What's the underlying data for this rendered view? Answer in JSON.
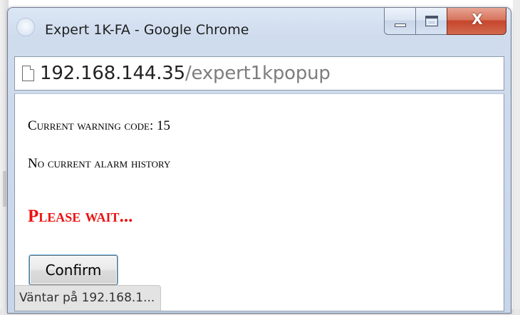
{
  "window": {
    "title": "Expert 1K-FA - Google Chrome",
    "close_glyph": "X"
  },
  "address_bar": {
    "host": "192.168.144.35",
    "path": "/expert1kpopup"
  },
  "content": {
    "warning_text": "Current warning code: 15",
    "alarm_text": "No current alarm history",
    "please_wait": "Please wait...",
    "confirm_label": "Confirm"
  },
  "status_bar": {
    "text": "Väntar på 192.168.1..."
  },
  "colors": {
    "please_wait": "#ee1111",
    "close_button": "#c6452b"
  },
  "icons": {
    "app": "chrome-app-icon",
    "page": "page-icon",
    "minimize": "minimize-icon",
    "maximize": "maximize-icon",
    "close": "close-icon"
  }
}
